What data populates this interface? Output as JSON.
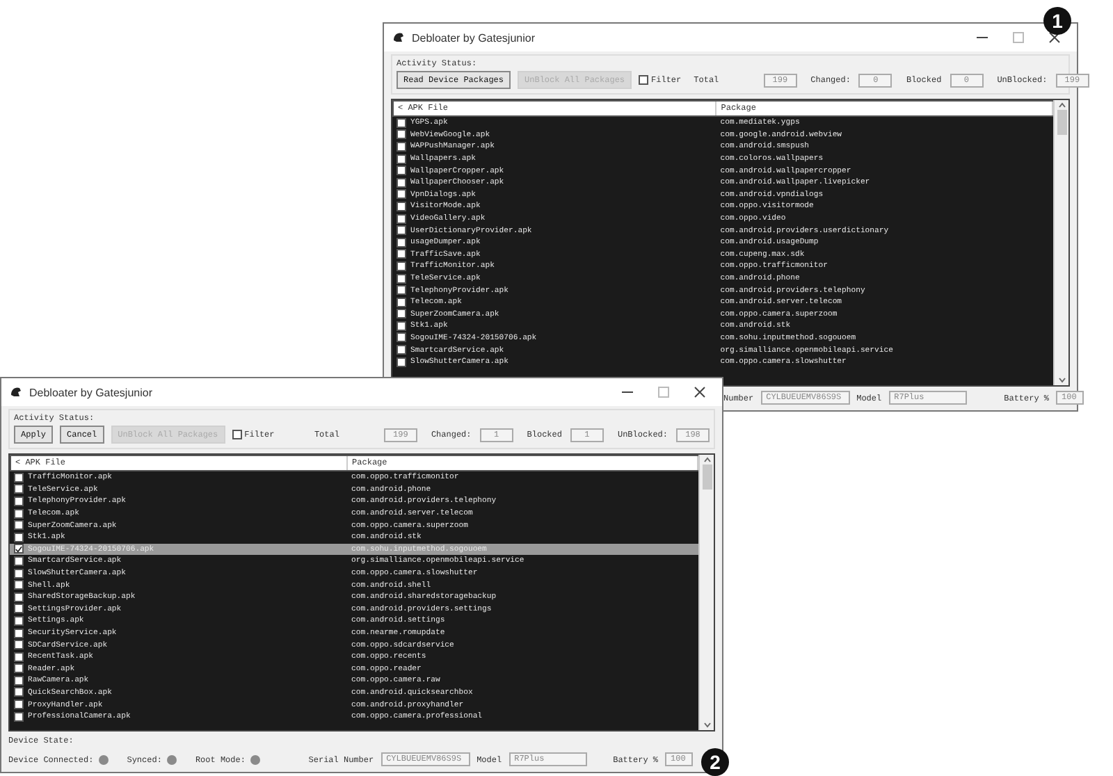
{
  "windows": [
    {
      "title": "Debloater by Gatesjunior",
      "activity_label": "Activity Status:",
      "buttons": [
        {
          "label": "Read Device Packages",
          "disabled": false
        },
        {
          "label": "UnBlock All Packages",
          "disabled": true
        }
      ],
      "filter": {
        "label": "Filter",
        "checked": false
      },
      "counters": [
        {
          "label": "Total",
          "value": "199"
        },
        {
          "label": "Changed:",
          "value": "0"
        },
        {
          "label": "Blocked",
          "value": "0"
        },
        {
          "label": "UnBlocked:",
          "value": "199"
        }
      ],
      "columns": [
        "< APK File",
        "Package"
      ],
      "rows": [
        {
          "apk": "YGPS.apk",
          "package": "com.mediatek.ygps",
          "checked": false,
          "selected": false
        },
        {
          "apk": "WebViewGoogle.apk",
          "package": "com.google.android.webview",
          "checked": false,
          "selected": false
        },
        {
          "apk": "WAPPushManager.apk",
          "package": "com.android.smspush",
          "checked": false,
          "selected": false
        },
        {
          "apk": "Wallpapers.apk",
          "package": "com.coloros.wallpapers",
          "checked": false,
          "selected": false
        },
        {
          "apk": "WallpaperCropper.apk",
          "package": "com.android.wallpapercropper",
          "checked": false,
          "selected": false
        },
        {
          "apk": "WallpaperChooser.apk",
          "package": "com.android.wallpaper.livepicker",
          "checked": false,
          "selected": false
        },
        {
          "apk": "VpnDialogs.apk",
          "package": "com.android.vpndialogs",
          "checked": false,
          "selected": false
        },
        {
          "apk": "VisitorMode.apk",
          "package": "com.oppo.visitormode",
          "checked": false,
          "selected": false
        },
        {
          "apk": "VideoGallery.apk",
          "package": "com.oppo.video",
          "checked": false,
          "selected": false
        },
        {
          "apk": "UserDictionaryProvider.apk",
          "package": "com.android.providers.userdictionary",
          "checked": false,
          "selected": false
        },
        {
          "apk": "usageDumper.apk",
          "package": "com.android.usageDump",
          "checked": false,
          "selected": false
        },
        {
          "apk": "TrafficSave.apk",
          "package": "com.cupeng.max.sdk",
          "checked": false,
          "selected": false
        },
        {
          "apk": "TrafficMonitor.apk",
          "package": "com.oppo.trafficmonitor",
          "checked": false,
          "selected": false
        },
        {
          "apk": "TeleService.apk",
          "package": "com.android.phone",
          "checked": false,
          "selected": false
        },
        {
          "apk": "TelephonyProvider.apk",
          "package": "com.android.providers.telephony",
          "checked": false,
          "selected": false
        },
        {
          "apk": "Telecom.apk",
          "package": "com.android.server.telecom",
          "checked": false,
          "selected": false
        },
        {
          "apk": "SuperZoomCamera.apk",
          "package": "com.oppo.camera.superzoom",
          "checked": false,
          "selected": false
        },
        {
          "apk": "Stk1.apk",
          "package": "com.android.stk",
          "checked": false,
          "selected": false
        },
        {
          "apk": "SogouIME-74324-20150706.apk",
          "package": "com.sohu.inputmethod.sogouoem",
          "checked": false,
          "selected": false
        },
        {
          "apk": "SmartcardService.apk",
          "package": "org.simalliance.openmobileapi.service",
          "checked": false,
          "selected": false
        },
        {
          "apk": "SlowShutterCamera.apk",
          "package": "com.oppo.camera.slowshutter",
          "checked": false,
          "selected": false
        }
      ],
      "status": {
        "fields": [
          {
            "label": "Number",
            "value": "CYLBUEUEMV86S9S"
          },
          {
            "label": "Model",
            "value": "R7Plus"
          },
          {
            "label": "Battery %",
            "value": "100"
          }
        ]
      }
    },
    {
      "title": "Debloater by Gatesjunior",
      "activity_label": "Activity Status:",
      "buttons": [
        {
          "label": "Apply",
          "disabled": false
        },
        {
          "label": "Cancel",
          "disabled": false
        },
        {
          "label": "UnBlock All Packages",
          "disabled": true
        }
      ],
      "filter": {
        "label": "Filter",
        "checked": false
      },
      "counters": [
        {
          "label": "Total",
          "value": "199"
        },
        {
          "label": "Changed:",
          "value": "1"
        },
        {
          "label": "Blocked",
          "value": "1"
        },
        {
          "label": "UnBlocked:",
          "value": "198"
        }
      ],
      "columns": [
        "< APK File",
        "Package"
      ],
      "rows": [
        {
          "apk": "TrafficMonitor.apk",
          "package": "com.oppo.trafficmonitor",
          "checked": false,
          "selected": false
        },
        {
          "apk": "TeleService.apk",
          "package": "com.android.phone",
          "checked": false,
          "selected": false
        },
        {
          "apk": "TelephonyProvider.apk",
          "package": "com.android.providers.telephony",
          "checked": false,
          "selected": false
        },
        {
          "apk": "Telecom.apk",
          "package": "com.android.server.telecom",
          "checked": false,
          "selected": false
        },
        {
          "apk": "SuperZoomCamera.apk",
          "package": "com.oppo.camera.superzoom",
          "checked": false,
          "selected": false
        },
        {
          "apk": "Stk1.apk",
          "package": "com.android.stk",
          "checked": false,
          "selected": false
        },
        {
          "apk": "SogouIME-74324-20150706.apk",
          "package": "com.sohu.inputmethod.sogouoem",
          "checked": true,
          "selected": true
        },
        {
          "apk": "SmartcardService.apk",
          "package": "org.simalliance.openmobileapi.service",
          "checked": false,
          "selected": false
        },
        {
          "apk": "SlowShutterCamera.apk",
          "package": "com.oppo.camera.slowshutter",
          "checked": false,
          "selected": false
        },
        {
          "apk": "Shell.apk",
          "package": "com.android.shell",
          "checked": false,
          "selected": false
        },
        {
          "apk": "SharedStorageBackup.apk",
          "package": "com.android.sharedstoragebackup",
          "checked": false,
          "selected": false
        },
        {
          "apk": "SettingsProvider.apk",
          "package": "com.android.providers.settings",
          "checked": false,
          "selected": false
        },
        {
          "apk": "Settings.apk",
          "package": "com.android.settings",
          "checked": false,
          "selected": false
        },
        {
          "apk": "SecurityService.apk",
          "package": "com.nearme.romupdate",
          "checked": false,
          "selected": false
        },
        {
          "apk": "SDCardService.apk",
          "package": "com.oppo.sdcardservice",
          "checked": false,
          "selected": false
        },
        {
          "apk": "RecentTask.apk",
          "package": "com.oppo.recents",
          "checked": false,
          "selected": false
        },
        {
          "apk": "Reader.apk",
          "package": "com.oppo.reader",
          "checked": false,
          "selected": false
        },
        {
          "apk": "RawCamera.apk",
          "package": "com.oppo.camera.raw",
          "checked": false,
          "selected": false
        },
        {
          "apk": "QuickSearchBox.apk",
          "package": "com.android.quicksearchbox",
          "checked": false,
          "selected": false
        },
        {
          "apk": "ProxyHandler.apk",
          "package": "com.android.proxyhandler",
          "checked": false,
          "selected": false
        },
        {
          "apk": "ProfessionalCamera.apk",
          "package": "com.oppo.camera.professional",
          "checked": false,
          "selected": false
        }
      ],
      "status": {
        "label": "Device State:",
        "indicators": [
          {
            "label": "Device Connected:",
            "on": false
          },
          {
            "label": "Synced:",
            "on": false
          },
          {
            "label": "Root Mode:",
            "on": false
          }
        ],
        "fields": [
          {
            "label": "Serial Number",
            "value": "CYLBUEUEMV86S9S"
          },
          {
            "label": "Model",
            "value": "R7Plus"
          },
          {
            "label": "Battery %",
            "value": "100"
          }
        ]
      }
    }
  ],
  "callouts": [
    {
      "label": "1"
    },
    {
      "label": "2"
    }
  ]
}
